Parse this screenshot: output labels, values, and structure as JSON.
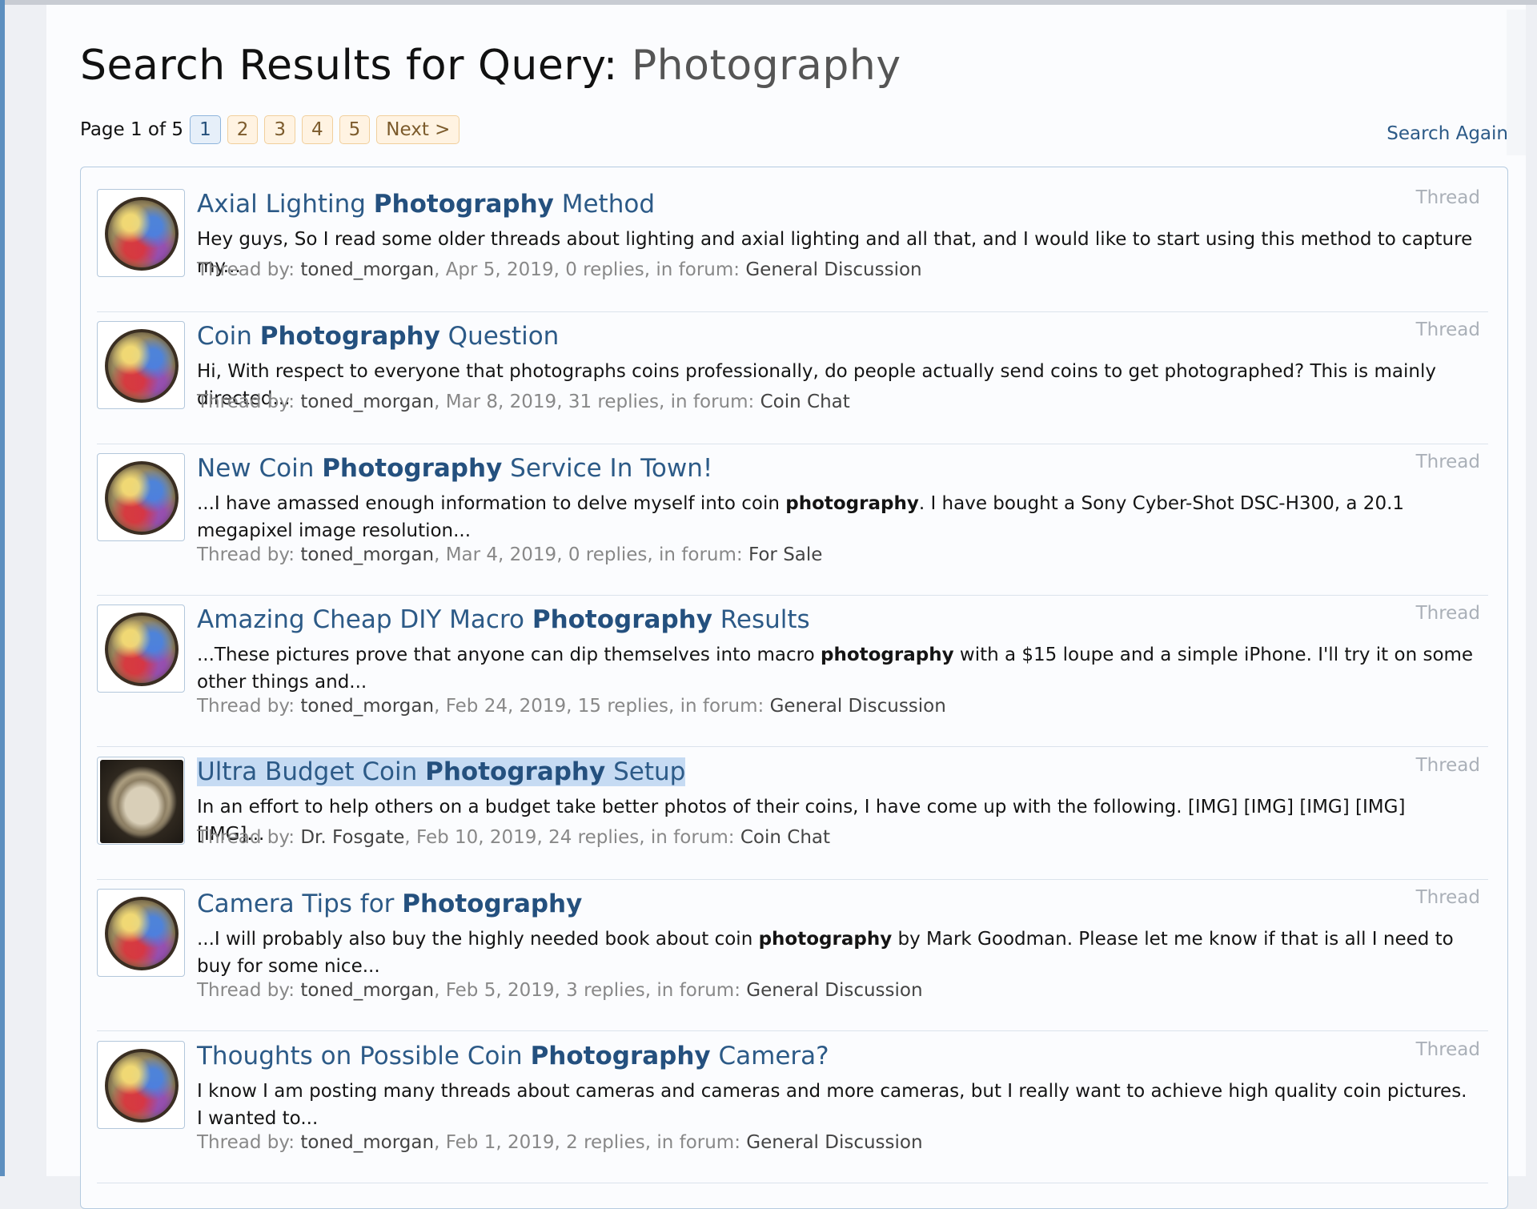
{
  "header": {
    "title_prefix": "Search Results for Query:",
    "query": "Photography"
  },
  "pagination": {
    "label": "Page 1 of 5",
    "pages": [
      "1",
      "2",
      "3",
      "4",
      "5"
    ],
    "current": "1",
    "next_label": "Next >"
  },
  "search_again_label": "Search Again",
  "meta_labels": {
    "thread_by": "Thread by:",
    "in_forum": "in forum:"
  },
  "results": [
    {
      "title_before": "Axial Lighting ",
      "title_keyword": "Photography",
      "title_after": " Method",
      "type": "Thread",
      "snippet_before": "Hey guys, So I read some older threads about lighting and axial lighting and all that, and I would like to start using this method to capture my...",
      "snippet_keyword": "",
      "snippet_after": "",
      "author": "toned_morgan",
      "date": "Apr 5, 2019",
      "replies": "0 replies",
      "forum": "General Discussion",
      "avatar_icon": "colorful-toned-coin-avatar"
    },
    {
      "title_before": "Coin ",
      "title_keyword": "Photography",
      "title_after": " Question",
      "type": "Thread",
      "snippet_before": "Hi, With respect to everyone that photographs coins professionally, do people actually send coins to get photographed? This is mainly directed...",
      "snippet_keyword": "",
      "snippet_after": "",
      "author": "toned_morgan",
      "date": "Mar 8, 2019",
      "replies": "31 replies",
      "forum": "Coin Chat",
      "avatar_icon": "colorful-toned-coin-avatar"
    },
    {
      "title_before": "New Coin ",
      "title_keyword": "Photography",
      "title_after": " Service In Town!",
      "type": "Thread",
      "snippet_before": "...I have amassed enough information to delve myself into coin ",
      "snippet_keyword": "photography",
      "snippet_after": ". I have bought a Sony Cyber-Shot DSC-H300, a 20.1 megapixel image resolution...",
      "author": "toned_morgan",
      "date": "Mar 4, 2019",
      "replies": "0 replies",
      "forum": "For Sale",
      "avatar_icon": "colorful-toned-coin-avatar"
    },
    {
      "title_before": "Amazing Cheap DIY Macro ",
      "title_keyword": "Photography",
      "title_after": " Results",
      "type": "Thread",
      "snippet_before": "...These pictures prove that anyone can dip themselves into macro ",
      "snippet_keyword": "photography",
      "snippet_after": " with a $15 loupe and a simple iPhone. I'll try it on some other things and...",
      "author": "toned_morgan",
      "date": "Feb 24, 2019",
      "replies": "15 replies",
      "forum": "General Discussion",
      "avatar_icon": "colorful-toned-coin-avatar"
    },
    {
      "title_before": "Ultra Budget Coin ",
      "title_keyword": "Photography",
      "title_after": " Setup",
      "type": "Thread",
      "snippet_before": "In an effort to help others on a budget take better photos of their coins, I have come up with the following. [IMG] [IMG] [IMG] [IMG] [IMG]...",
      "snippet_keyword": "",
      "snippet_after": "",
      "author": "Dr. Fosgate",
      "date": "Feb 10, 2019",
      "replies": "24 replies",
      "forum": "Coin Chat",
      "avatar_icon": "buffalo-nickel-avatar",
      "selected": true
    },
    {
      "title_before": "Camera Tips for ",
      "title_keyword": "Photography",
      "title_after": "",
      "type": "Thread",
      "snippet_before": "...I will probably also buy the highly needed book about coin ",
      "snippet_keyword": "photography",
      "snippet_after": " by Mark Goodman. Please let me know if that is all I need to buy for some nice...",
      "author": "toned_morgan",
      "date": "Feb 5, 2019",
      "replies": "3 replies",
      "forum": "General Discussion",
      "avatar_icon": "colorful-toned-coin-avatar"
    },
    {
      "title_before": "Thoughts on Possible Coin ",
      "title_keyword": "Photography",
      "title_after": " Camera?",
      "type": "Thread",
      "snippet_before": "I know I am posting many threads about cameras and cameras and more cameras, but I really want to achieve high quality coin pictures. I wanted to...",
      "snippet_keyword": "",
      "snippet_after": "",
      "author": "toned_morgan",
      "date": "Feb 1, 2019",
      "replies": "2 replies",
      "forum": "General Discussion",
      "avatar_icon": "colorful-toned-coin-avatar"
    }
  ]
}
